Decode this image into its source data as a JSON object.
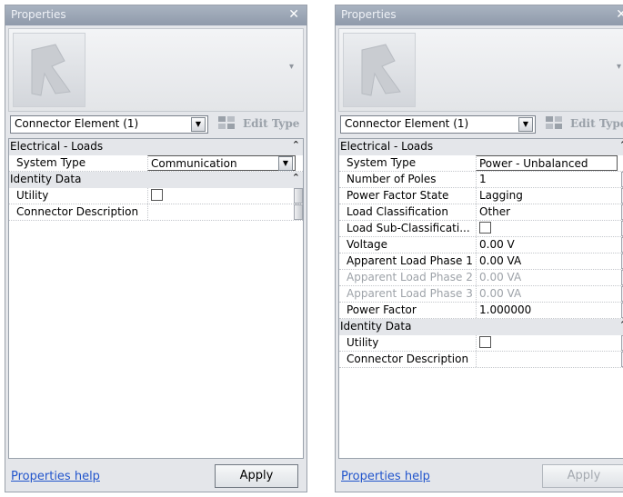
{
  "left_panel": {
    "title": "Properties",
    "close_glyph": "✕",
    "preview_dropdown_glyph": "▾",
    "selector_label": "Connector Element (1)",
    "edit_type_label": "Edit Type",
    "categories": [
      {
        "name": "Electrical - Loads",
        "collapse_glyph": "⌃⌃",
        "properties": [
          {
            "label": "System Type",
            "value": "Communication",
            "dropdown": true
          }
        ]
      },
      {
        "name": "Identity Data",
        "collapse_glyph": "⌃⌃",
        "properties": [
          {
            "label": "Utility",
            "checkbox": true,
            "checked": false
          },
          {
            "label": "Connector Description",
            "value": ""
          }
        ]
      }
    ],
    "help_link": "Properties help",
    "apply_label": "Apply",
    "apply_enabled": true
  },
  "right_panel": {
    "title": "Properties",
    "close_glyph": "✕",
    "preview_dropdown_glyph": "▾",
    "selector_label": "Connector Element (1)",
    "edit_type_label": "Edit Type",
    "categories": [
      {
        "name": "Electrical - Loads",
        "collapse_glyph": "⌃⌃",
        "properties": [
          {
            "label": "System Type",
            "value": "Power - Unbalanced",
            "boxed": true
          },
          {
            "label": "Number of Poles",
            "value": "1"
          },
          {
            "label": "Power Factor State",
            "value": "Lagging"
          },
          {
            "label": "Load Classification",
            "value": "Other"
          },
          {
            "label": "Load Sub-Classificati...",
            "checkbox": true,
            "checked": false
          },
          {
            "label": "Voltage",
            "value": "0.00 V"
          },
          {
            "label": "Apparent Load Phase 1",
            "value": "0.00 VA"
          },
          {
            "label": "Apparent Load Phase 2",
            "value": "0.00 VA",
            "disabled": true
          },
          {
            "label": "Apparent Load Phase 3",
            "value": "0.00 VA",
            "disabled": true
          },
          {
            "label": "Power Factor",
            "value": "1.000000"
          }
        ]
      },
      {
        "name": "Identity Data",
        "collapse_glyph": "⌃⌃",
        "properties": [
          {
            "label": "Utility",
            "checkbox": true,
            "checked": false
          },
          {
            "label": "Connector Description",
            "value": ""
          }
        ]
      }
    ],
    "help_link": "Properties help",
    "apply_label": "Apply",
    "apply_enabled": false
  },
  "icons": {
    "close": "close-icon",
    "family_preview": "revit-family-icon",
    "dropdown": "chevron-down-icon",
    "edit_type": "edit-type-icon",
    "collapse": "collapse-chevrons-icon"
  },
  "colors": {
    "titlebar": "#9aa4b3",
    "panel": "#e4e6ea",
    "link": "#2255cc",
    "disabled_text": "#9ea3a9"
  }
}
